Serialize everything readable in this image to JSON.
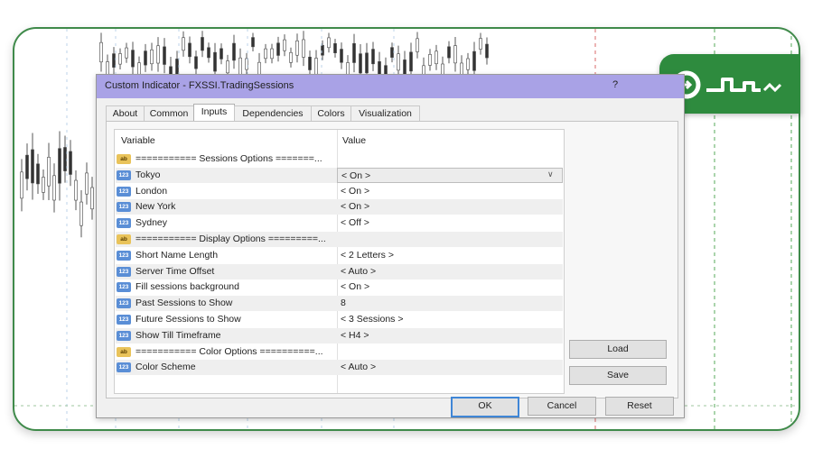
{
  "dialog": {
    "title": "Custom Indicator - FXSSI.TradingSessions",
    "help": "?"
  },
  "tabs": [
    {
      "label": "About"
    },
    {
      "label": "Common"
    },
    {
      "label": "Inputs"
    },
    {
      "label": "Dependencies"
    },
    {
      "label": "Colors"
    },
    {
      "label": "Visualization"
    }
  ],
  "active_tab": "Inputs",
  "grid": {
    "headers": {
      "variable": "Variable",
      "value": "Value"
    },
    "rows": [
      {
        "type": "ab",
        "variable": "=========== Sessions Options =======...",
        "value": ""
      },
      {
        "type": "num",
        "variable": "Tokyo",
        "value": "< On >"
      },
      {
        "type": "num",
        "variable": "London",
        "value": "< On >"
      },
      {
        "type": "num",
        "variable": "New York",
        "value": "< On >"
      },
      {
        "type": "num",
        "variable": "Sydney",
        "value": "< Off >"
      },
      {
        "type": "ab",
        "variable": "=========== Display Options =========...",
        "value": ""
      },
      {
        "type": "num",
        "variable": "Short Name Length",
        "value": "< 2 Letters >"
      },
      {
        "type": "num",
        "variable": "Server Time Offset",
        "value": "< Auto >"
      },
      {
        "type": "num",
        "variable": "Fill sessions background",
        "value": "< On >"
      },
      {
        "type": "num",
        "variable": "Past Sessions to Show",
        "value": "8"
      },
      {
        "type": "num",
        "variable": "Future Sessions to Show",
        "value": "< 3 Sessions >"
      },
      {
        "type": "num",
        "variable": "Show Till Timeframe",
        "value": "< H4 >"
      },
      {
        "type": "ab",
        "variable": "=========== Color Options ==========...",
        "value": ""
      },
      {
        "type": "num",
        "variable": "Color Scheme",
        "value": "< Auto >"
      }
    ],
    "icon_labels": {
      "num": "123",
      "ab": "ab"
    }
  },
  "side_buttons": {
    "load": "Load",
    "save": "Save"
  },
  "footer_buttons": {
    "ok": "OK",
    "cancel": "Cancel",
    "reset": "Reset"
  },
  "colors": {
    "frame_border": "#3f8a4a",
    "logo_bg": "#2e8b3e",
    "titlebar": "#a9a2e6"
  }
}
